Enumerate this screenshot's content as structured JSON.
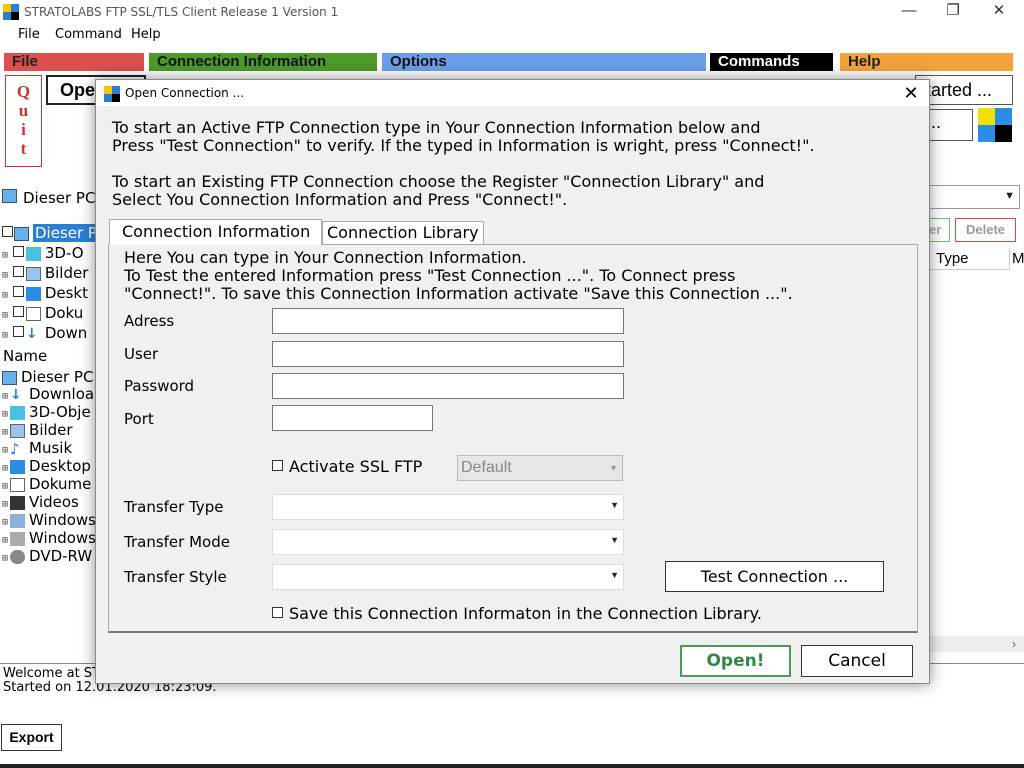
{
  "window": {
    "title": "STRATOLABS FTP SSL/TLS Client Release 1 Version 1",
    "minimize": "—",
    "maximize": "❐",
    "close": "✕"
  },
  "menu": {
    "file": "File",
    "command": "Command",
    "help": "Help"
  },
  "ribbon": {
    "file": "File",
    "connection_information": "Connection Information",
    "options": "Options",
    "commands": "Commands",
    "help": "Help",
    "colors": {
      "file": "#d9504f",
      "connection": "#4c9a2a",
      "options": "#6a9ee8",
      "commands": "#000000",
      "help": "#f2a33a"
    }
  },
  "toolbar": {
    "quit_letters": [
      "Q",
      "u",
      "i",
      "t"
    ],
    "open_label": "Ope",
    "started_label": "tarted ...",
    "dots_label": "..."
  },
  "left_panel": {
    "pc_combo": "Dieser PC",
    "tree": [
      {
        "label": "Dieser P",
        "selected": true
      },
      {
        "label": "3D-O"
      },
      {
        "label": "Bilder"
      },
      {
        "label": "Deskt"
      },
      {
        "label": "Doku"
      },
      {
        "label": "Down"
      }
    ],
    "list_header": "Name",
    "list_root": "Dieser PC",
    "list": [
      {
        "label": "Downloa"
      },
      {
        "label": "3D-Obje"
      },
      {
        "label": "Bilder"
      },
      {
        "label": "Musik"
      },
      {
        "label": "Desktop"
      },
      {
        "label": "Dokume"
      },
      {
        "label": "Videos"
      },
      {
        "label": "Windows"
      },
      {
        "label": "Windows"
      },
      {
        "label": "DVD-RW"
      }
    ]
  },
  "right_panel": {
    "er_label": "er",
    "delete_label": "Delete",
    "col_type": "Type",
    "col_m": "M"
  },
  "log": {
    "line1": "Welcome at ST",
    "line2": "Started on 12.01.2020 18:23:09.",
    "export": "Export"
  },
  "dialog": {
    "title": "Open Connection ...",
    "close": "✕",
    "intro": [
      "To start an Active FTP Connection type in Your Connection Information below and",
      "Press \"Test Connection\" to verify. If the typed in Information is wright, press \"Connect!\".",
      "To start an Existing FTP Connection choose the Register \"Connection Library\" and",
      "Select You Connection Information and Press \"Connect!\"."
    ],
    "tabs": {
      "active": "Connection Information",
      "inactive": "Connection Library"
    },
    "panel_intro": [
      "Here You can type in Your Connection Information.",
      "To Test the entered Information press \"Test Connection ...\". To Connect press",
      "\"Connect!\".  To save this Connection Information activate \"Save this Connection ...\"."
    ],
    "fields": {
      "adress": {
        "label": "Adress",
        "value": ""
      },
      "user": {
        "label": "User",
        "value": ""
      },
      "password": {
        "label": "Password",
        "value": ""
      },
      "port": {
        "label": "Port",
        "value": ""
      }
    },
    "ssl": {
      "label": "Activate SSL FTP",
      "checked": false,
      "combo_value": "Default"
    },
    "transfer_type": {
      "label": "Transfer Type",
      "value": ""
    },
    "transfer_mode": {
      "label": "Transfer Mode",
      "value": ""
    },
    "transfer_style": {
      "label": "Transfer Style",
      "value": ""
    },
    "test_button": "Test Connection ...",
    "save_label": "Save this Connection Informaton in the Connection Library.",
    "open_button": "Open!",
    "cancel_button": "Cancel"
  }
}
